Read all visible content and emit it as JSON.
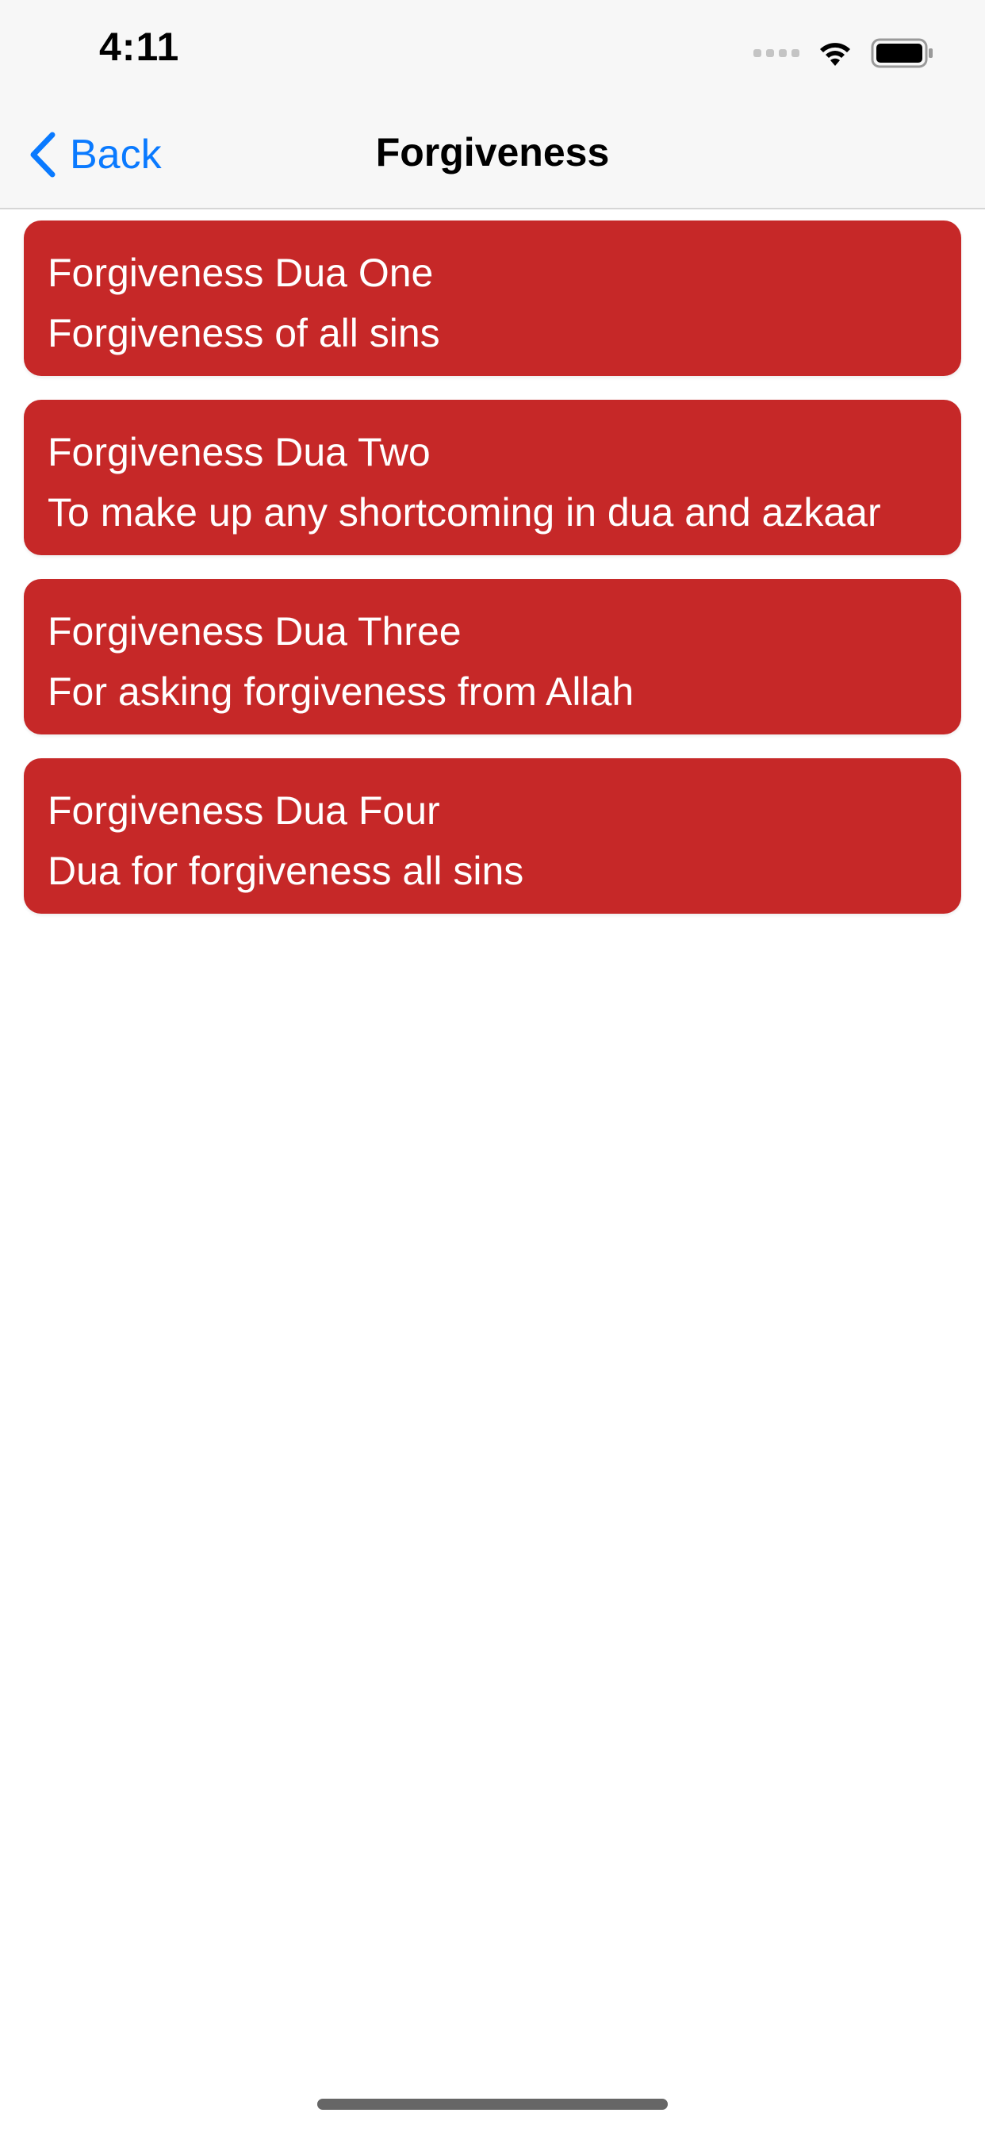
{
  "status_bar": {
    "time": "4:11",
    "icons": [
      "signal-icon",
      "wifi-icon",
      "battery-icon"
    ]
  },
  "nav": {
    "back_label": "Back",
    "title": "Forgiveness",
    "accent_color": "#0a7aff"
  },
  "duas": [
    {
      "title": "Forgiveness Dua One",
      "subtitle": "Forgiveness of all sins"
    },
    {
      "title": "Forgiveness Dua Two",
      "subtitle": "To make up any shortcoming in dua and azkaar"
    },
    {
      "title": "Forgiveness Dua Three",
      "subtitle": "For asking forgiveness from Allah"
    },
    {
      "title": "Forgiveness Dua Four",
      "subtitle": "Dua for forgiveness all sins"
    }
  ],
  "colors": {
    "card_background": "#c62828",
    "card_text": "#ffffff",
    "nav_background": "#f7f7f7"
  }
}
